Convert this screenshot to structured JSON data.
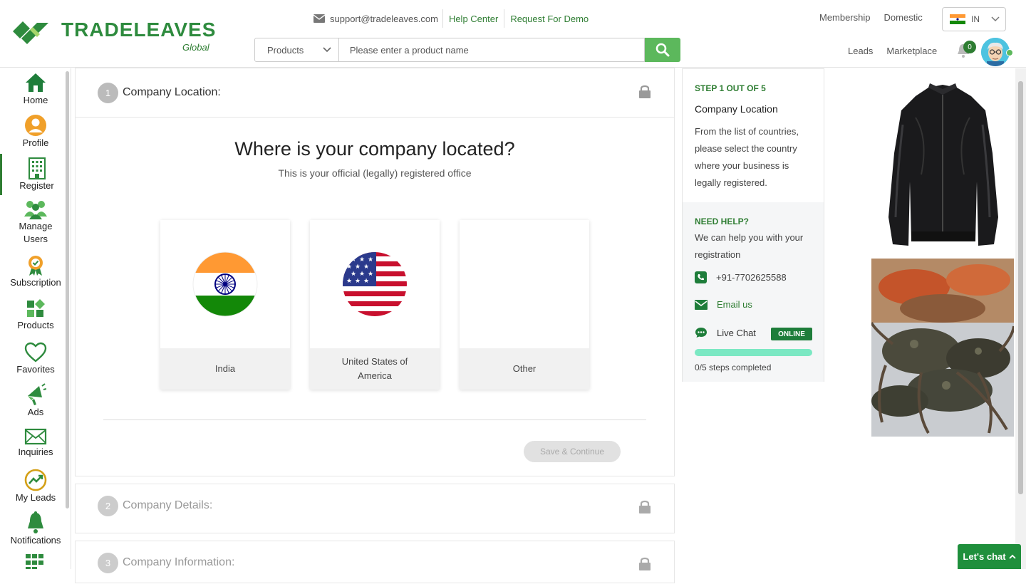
{
  "brand": {
    "name": "TRADELEAVES",
    "sub": "Global",
    "colors": {
      "primary": "#2e8b3e",
      "accent": "#5cb85c"
    }
  },
  "header": {
    "support_email": "support@tradeleaves.com",
    "help_center": "Help Center",
    "request_demo": "Request For Demo",
    "membership": "Membership",
    "domestic": "Domestic",
    "country_code": "IN",
    "leads": "Leads",
    "marketplace": "Marketplace",
    "notification_count": "0",
    "search": {
      "category": "Products",
      "placeholder": "Please enter a product name"
    }
  },
  "sidebar": {
    "items": [
      {
        "label": "Home",
        "icon": "home-icon"
      },
      {
        "label": "Profile",
        "icon": "profile-icon"
      },
      {
        "label": "Register",
        "icon": "building-icon",
        "active": true
      },
      {
        "label": "Manage Users",
        "icon": "users-icon"
      },
      {
        "label": "Subscription",
        "icon": "badge-icon"
      },
      {
        "label": "Products",
        "icon": "products-icon"
      },
      {
        "label": "Favorites",
        "icon": "heart-icon"
      },
      {
        "label": "Ads",
        "icon": "megaphone-icon"
      },
      {
        "label": "Inquiries",
        "icon": "envelope-icon"
      },
      {
        "label": "My Leads",
        "icon": "leads-icon"
      },
      {
        "label": "Notifications",
        "icon": "bell-icon"
      }
    ]
  },
  "steps": [
    {
      "num": "1",
      "title": "Company Location:"
    },
    {
      "num": "2",
      "title": "Company Details:"
    },
    {
      "num": "3",
      "title": "Company Information:"
    }
  ],
  "location": {
    "question": "Where is your company located?",
    "subtitle": "This is your official (legally) registered office",
    "options": [
      {
        "label": "India",
        "flag": "india-flag"
      },
      {
        "label": "United States of America",
        "flag": "usa-flag"
      },
      {
        "label": "Other",
        "flag": ""
      }
    ],
    "save_button": "Save & Continue"
  },
  "info": {
    "step_label": "STEP 1 OUT OF 5",
    "title": "Company Location",
    "description": "From the list of countries, please select the country where your business is legally registered.",
    "help_heading": "NEED HELP?",
    "help_text": "We can help you with your registration",
    "phone": "+91-7702625588",
    "email": "Email us",
    "chat": "Live Chat",
    "online_badge": "ONLINE",
    "steps_completed": "0/5 steps completed",
    "progress_fraction": 0
  },
  "chat_button": "Let's chat"
}
